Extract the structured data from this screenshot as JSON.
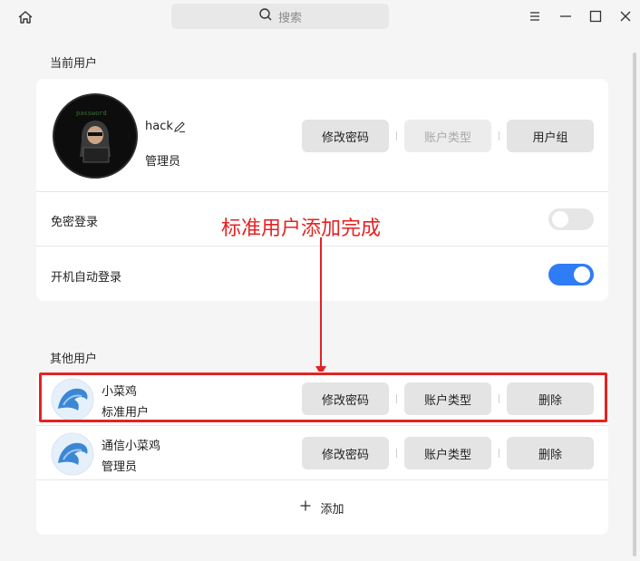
{
  "titlebar": {
    "search_placeholder": "搜索",
    "icons": [
      "home-icon",
      "search-icon",
      "menu-icon",
      "minimize-icon",
      "maximize-icon",
      "close-icon"
    ]
  },
  "current_user": {
    "section_title": "当前用户",
    "name": "hack",
    "role": "管理员",
    "buttons": {
      "change_password": "修改密码",
      "account_type": "账户类型",
      "user_group": "用户组"
    },
    "settings": [
      {
        "label": "免密登录",
        "enabled": false
      },
      {
        "label": "开机自动登录",
        "enabled": true
      }
    ]
  },
  "annotation": {
    "text": "标准用户添加完成",
    "color": "#e52222"
  },
  "other_users": {
    "section_title": "其他用户",
    "users": [
      {
        "name": "小菜鸡",
        "role": "标准用户",
        "change_password": "修改密码",
        "account_type": "账户类型",
        "delete": "删除"
      },
      {
        "name": "通信小菜鸡",
        "role": "管理员",
        "change_password": "修改密码",
        "account_type": "账户类型",
        "delete": "删除"
      }
    ],
    "add_label": "添加"
  },
  "colors": {
    "accent": "#2e7cf6",
    "highlight": "#e52222",
    "background": "#f5f5f5",
    "card": "#ffffff"
  }
}
